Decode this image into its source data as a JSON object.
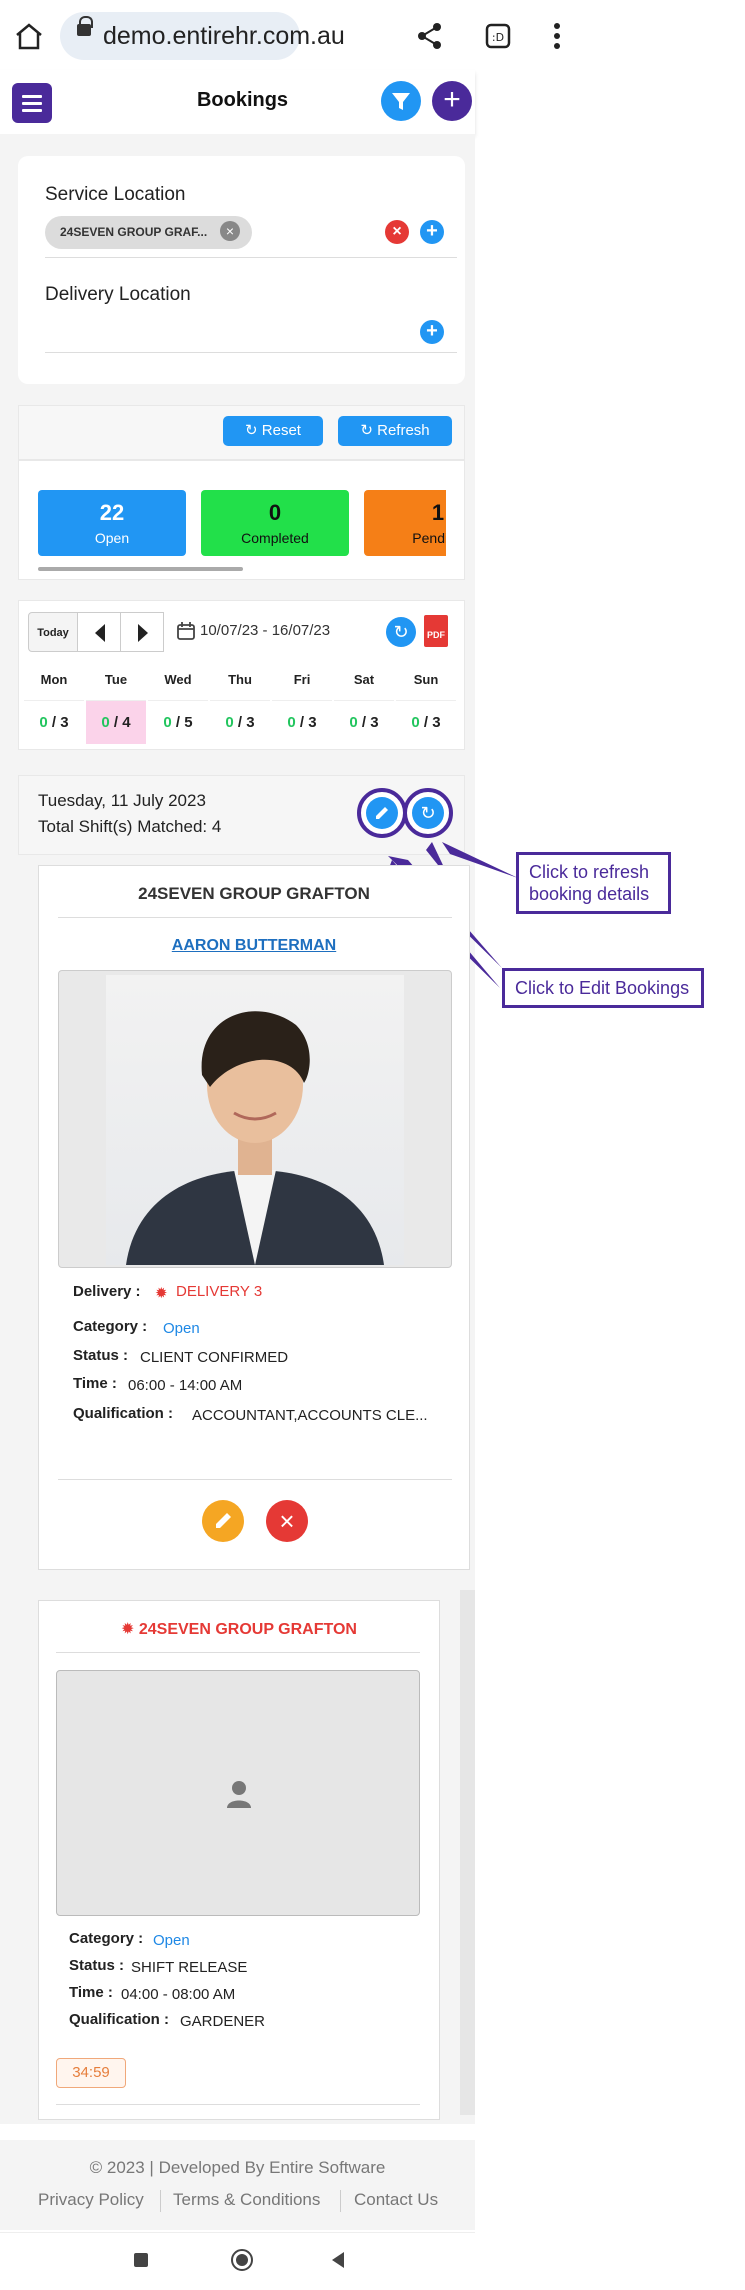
{
  "browser": {
    "url": "demo.entirehr.com.au"
  },
  "header": {
    "title": "Bookings"
  },
  "filters": {
    "service_location_label": "Service Location",
    "service_location_chip": "24SEVEN GROUP GRAF...",
    "delivery_location_label": "Delivery Location"
  },
  "toolbar": {
    "reset_label": "Reset",
    "refresh_label": "Refresh"
  },
  "stats": [
    {
      "value": "22",
      "label": "Open",
      "color": "#2196f3"
    },
    {
      "value": "0",
      "label": "Completed",
      "color": "#22e04a"
    },
    {
      "value": "1",
      "label": "Pending",
      "color": "#f57f17"
    }
  ],
  "week": {
    "today_label": "Today",
    "range": "10/07/23 - 16/07/23",
    "days": [
      {
        "name": "Mon",
        "filled": "0",
        "total": "3"
      },
      {
        "name": "Tue",
        "filled": "0",
        "total": "4"
      },
      {
        "name": "Wed",
        "filled": "0",
        "total": "5"
      },
      {
        "name": "Thu",
        "filled": "0",
        "total": "3"
      },
      {
        "name": "Fri",
        "filled": "0",
        "total": "3"
      },
      {
        "name": "Sat",
        "filled": "0",
        "total": "3"
      },
      {
        "name": "Sun",
        "filled": "0",
        "total": "3"
      }
    ]
  },
  "date_block": {
    "date": "Tuesday, 11 July 2023",
    "matched": "Total Shift(s) Matched: 4"
  },
  "callouts": {
    "refresh": "Click to refresh booking details",
    "edit": "Click to Edit Bookings"
  },
  "booking1": {
    "title": "24SEVEN GROUP GRAFTON",
    "employee": "AARON BUTTERMAN",
    "delivery_label": "Delivery :",
    "delivery_value": "DELIVERY 3",
    "category_label": "Category :",
    "category_value": "Open",
    "status_label": "Status :",
    "status_value": "CLIENT CONFIRMED",
    "time_label": "Time :",
    "time_value": "06:00 - 14:00 AM",
    "qualification_label": "Qualification :",
    "qualification_value": "ACCOUNTANT,ACCOUNTS CLE..."
  },
  "booking2": {
    "title": "24SEVEN GROUP GRAFTON",
    "category_label": "Category :",
    "category_value": "Open",
    "status_label": "Status :",
    "status_value": "SHIFT RELEASE",
    "time_label": "Time :",
    "time_value": "04:00 - 08:00 AM",
    "qualification_label": "Qualification :",
    "qualification_value": "GARDENER",
    "timer": "34:59"
  },
  "footer": {
    "copyright": "2023 | Developed By Entire Software",
    "links": [
      "Privacy Policy",
      "Terms & Conditions",
      "Contact Us"
    ]
  },
  "colors": {
    "primary": "#4a2a9a",
    "accent": "#2196f3",
    "danger": "#e53935",
    "warning": "#f5a623"
  }
}
